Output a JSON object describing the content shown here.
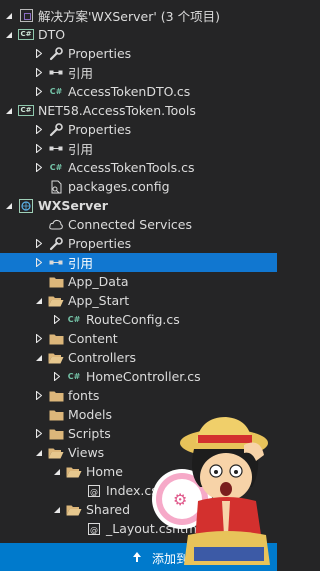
{
  "solution": {
    "label": "解决方案'WXServer' (3 个项目)"
  },
  "tree": [
    {
      "label": "DTO",
      "icon": "csharp-project-icon",
      "arrow": "expanded",
      "level": 1,
      "bold": false
    },
    {
      "label": "Properties",
      "icon": "wrench-icon",
      "arrow": "collapsed",
      "level": 2,
      "bold": false
    },
    {
      "label": "引用",
      "icon": "references-icon",
      "arrow": "collapsed",
      "level": 2,
      "bold": false
    },
    {
      "label": "AccessTokenDTO.cs",
      "icon": "csharp-file-icon",
      "arrow": "collapsed",
      "level": 2,
      "bold": false
    },
    {
      "label": "NET58.AccessToken.Tools",
      "icon": "csharp-project-icon",
      "arrow": "expanded",
      "level": 1,
      "bold": false
    },
    {
      "label": "Properties",
      "icon": "wrench-icon",
      "arrow": "collapsed",
      "level": 2,
      "bold": false
    },
    {
      "label": "引用",
      "icon": "references-icon",
      "arrow": "collapsed",
      "level": 2,
      "bold": false
    },
    {
      "label": "AccessTokenTools.cs",
      "icon": "csharp-file-icon",
      "arrow": "collapsed",
      "level": 2,
      "bold": false
    },
    {
      "label": "packages.config",
      "icon": "config-file-icon",
      "arrow": "none",
      "level": 2,
      "bold": false
    },
    {
      "label": "WXServer",
      "icon": "web-project-icon",
      "arrow": "expanded",
      "level": 1,
      "bold": true
    },
    {
      "label": "Connected Services",
      "icon": "connected-services-icon",
      "arrow": "none",
      "level": 2,
      "bold": false
    },
    {
      "label": "Properties",
      "icon": "wrench-icon",
      "arrow": "collapsed",
      "level": 2,
      "bold": false
    },
    {
      "label": "引用",
      "icon": "references-icon",
      "arrow": "collapsed",
      "level": 2,
      "bold": false,
      "selected": true
    },
    {
      "label": "App_Data",
      "icon": "folder-icon",
      "arrow": "none",
      "level": 2,
      "bold": false
    },
    {
      "label": "App_Start",
      "icon": "folder-open-icon",
      "arrow": "expanded",
      "level": 2,
      "bold": false
    },
    {
      "label": "RouteConfig.cs",
      "icon": "csharp-file-icon",
      "arrow": "collapsed",
      "level": 3,
      "bold": false
    },
    {
      "label": "Content",
      "icon": "folder-icon",
      "arrow": "collapsed",
      "level": 2,
      "bold": false
    },
    {
      "label": "Controllers",
      "icon": "folder-open-icon",
      "arrow": "expanded",
      "level": 2,
      "bold": false
    },
    {
      "label": "HomeController.cs",
      "icon": "csharp-file-icon",
      "arrow": "collapsed",
      "level": 3,
      "bold": false
    },
    {
      "label": "fonts",
      "icon": "folder-icon",
      "arrow": "collapsed",
      "level": 2,
      "bold": false
    },
    {
      "label": "Models",
      "icon": "folder-icon",
      "arrow": "none",
      "level": 2,
      "bold": false
    },
    {
      "label": "Scripts",
      "icon": "folder-icon",
      "arrow": "collapsed",
      "level": 2,
      "bold": false
    },
    {
      "label": "Views",
      "icon": "folder-open-icon",
      "arrow": "expanded",
      "level": 2,
      "bold": false
    },
    {
      "label": "Home",
      "icon": "folder-open-icon",
      "arrow": "expanded",
      "level": 3,
      "bold": false
    },
    {
      "label": "Index.cshtml",
      "icon": "razor-file-icon",
      "arrow": "none",
      "level": 4,
      "bold": false
    },
    {
      "label": "Shared",
      "icon": "folder-open-icon",
      "arrow": "expanded",
      "level": 3,
      "bold": false
    },
    {
      "label": "_Layout.cshtml",
      "icon": "razor-file-icon",
      "arrow": "none",
      "level": 4,
      "bold": false
    }
  ],
  "statusbar": {
    "text": "添加到源代码管理",
    "icon": "arrow-up-icon"
  },
  "colors": {
    "background": "#252526",
    "selection": "#1177d0",
    "statusbar": "#007acc",
    "folder": "#dcb67a"
  }
}
